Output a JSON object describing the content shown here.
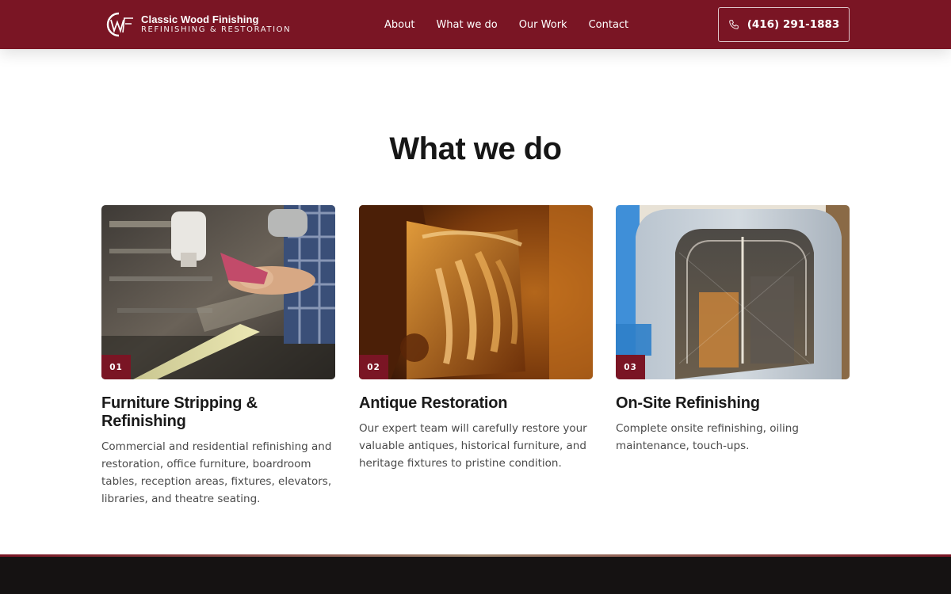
{
  "header": {
    "brand_name": "Classic Wood Finishing",
    "brand_tagline": "Refinishing & Restoration",
    "logo_letters": "CWF",
    "nav": [
      {
        "label": "About"
      },
      {
        "label": "What we do"
      },
      {
        "label": "Our Work"
      },
      {
        "label": "Contact"
      }
    ],
    "phone": "(416) 291-1883",
    "phone_icon": "phone-icon",
    "brand_color": "#7a1524"
  },
  "section": {
    "title": "What we do",
    "cards": [
      {
        "number": "01",
        "title": "Furniture Stripping & Refinishing",
        "description": "Commercial and residential refinishing and restoration, office furniture, boardroom tables, reception areas, fixtures, elevators, libraries, and theatre seating.",
        "image": "spray-gun-refinishing-photo"
      },
      {
        "number": "02",
        "title": "Antique Restoration",
        "description": "Our expert team will carefully restore your valuable antiques, historical furniture, and heritage fixtures to pristine condition.",
        "image": "carved-wood-antique-photo"
      },
      {
        "number": "03",
        "title": "On-Site Refinishing",
        "description": "Complete onsite refinishing, oiling maintenance, touch-ups.",
        "image": "inflatable-spray-booth-photo"
      }
    ]
  },
  "footer": {
    "background": "#151212"
  }
}
